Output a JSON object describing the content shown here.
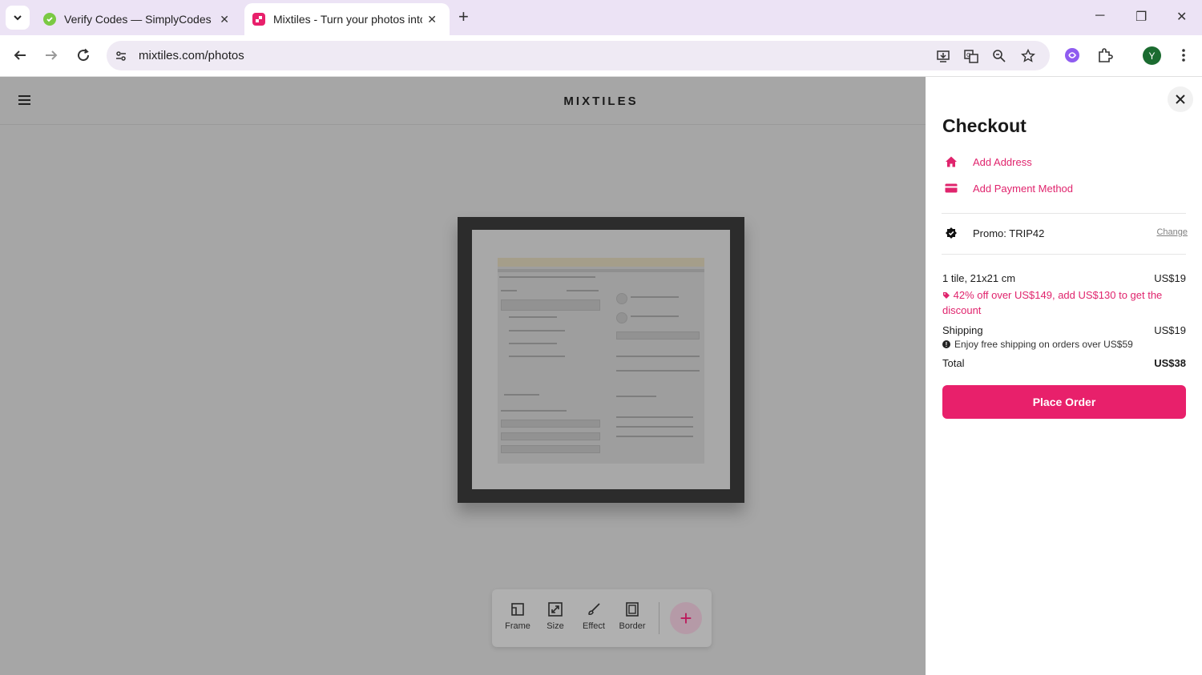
{
  "browser": {
    "tabs": [
      {
        "title": "Verify Codes — SimplyCodes",
        "active": false
      },
      {
        "title": "Mixtiles - Turn your photos into",
        "active": true
      }
    ],
    "url": "mixtiles.com/photos",
    "profile_initial": "Y",
    "icons": [
      "tab-search-icon",
      "close-icon",
      "new-tab-icon",
      "minimize-icon",
      "restore-icon",
      "back-icon",
      "forward-icon",
      "reload-icon",
      "site-settings-icon",
      "install-app-icon",
      "translate-icon",
      "zoom-icon",
      "bookmark-star-icon",
      "extension-icon",
      "puzzle-icon",
      "more-icon"
    ]
  },
  "site": {
    "logo": "MIXTILES"
  },
  "editor": {
    "tools": [
      {
        "label": "Frame",
        "icon": "frame-icon"
      },
      {
        "label": "Size",
        "icon": "resize-icon"
      },
      {
        "label": "Effect",
        "icon": "brush-icon"
      },
      {
        "label": "Border",
        "icon": "border-icon"
      }
    ],
    "add_label": "+"
  },
  "checkout": {
    "title": "Checkout",
    "add_address": "Add Address",
    "add_payment": "Add Payment Method",
    "promo": "Promo: TRIP42",
    "change": "Change",
    "item": {
      "label": "1 tile, 21x21 cm",
      "amount": "US$19"
    },
    "discount_message": "42% off over US$149, add US$130 to get the discount",
    "shipping": {
      "label": "Shipping",
      "amount": "US$19"
    },
    "shipping_note": "Enjoy free shipping on orders over US$59",
    "total": {
      "label": "Total",
      "amount": "US$38"
    },
    "place_order": "Place Order",
    "colors": {
      "accent": "#e8206b",
      "link": "#e0246d"
    }
  }
}
